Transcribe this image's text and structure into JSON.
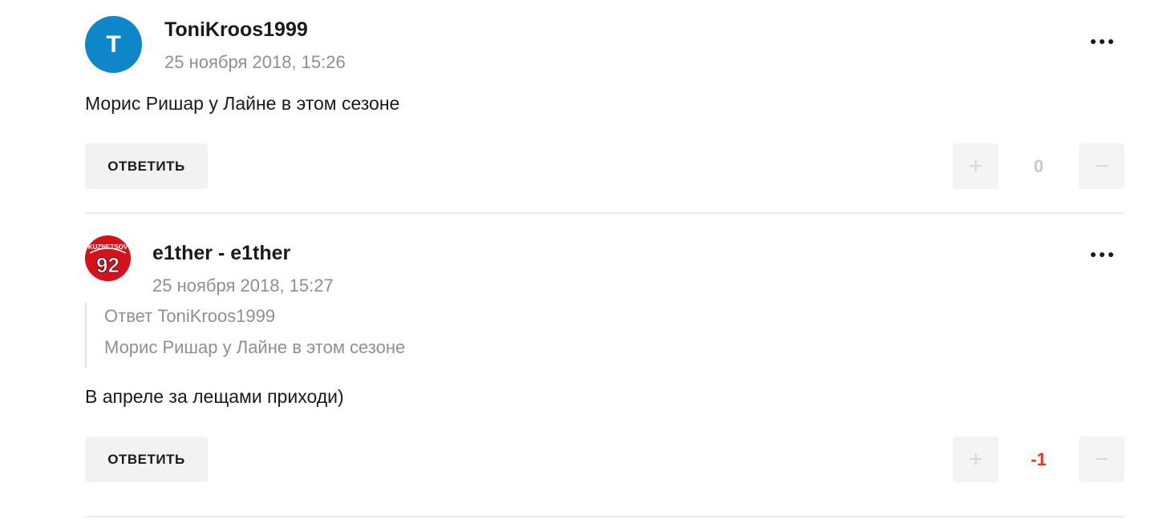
{
  "comments": [
    {
      "author": "ToniKroos1999",
      "avatar_letter": "T",
      "date": "25 ноября 2018, 15:26",
      "text": "Морис Ришар у Лайне в этом сезоне",
      "reply_label": "ОТВЕТИТЬ",
      "plus_symbol": "+",
      "minus_symbol": "−",
      "score": "0",
      "score_color": "#c9c9c9"
    },
    {
      "author": "e1ther - e1ther",
      "avatar_logo_text": "KUZNETSOV",
      "avatar_logo_number": "92",
      "date": "25 ноября 2018, 15:27",
      "quote": {
        "prefix": "Ответ",
        "author": "ToniKroos1999",
        "text": "Морис Ришар у Лайне в этом сезоне"
      },
      "text": "В апреле за лещами приходи)",
      "reply_label": "ОТВЕТИТЬ",
      "plus_symbol": "+",
      "minus_symbol": "−",
      "score": "-1",
      "score_color": "#e5322d"
    }
  ],
  "colors": {
    "avatar_letter_bg": "#0e86c9",
    "avatar_logo_bg": "#d4121c"
  },
  "icons": {
    "more": "more-dots-icon"
  }
}
